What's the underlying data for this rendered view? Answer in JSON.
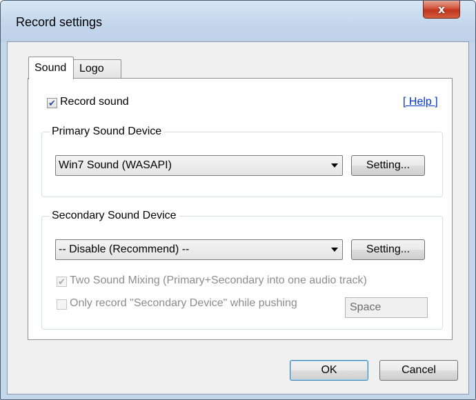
{
  "window": {
    "title": "Record settings",
    "close_glyph": "x"
  },
  "tabs": [
    {
      "label": "Sound",
      "selected": true
    },
    {
      "label": "Logo",
      "selected": false
    }
  ],
  "sound_tab": {
    "record_sound": {
      "label": "Record sound",
      "checked": true
    },
    "help_link": "[ Help ]",
    "primary": {
      "legend": "Primary Sound Device",
      "device": "Win7 Sound (WASAPI)",
      "setting_button": "Setting..."
    },
    "secondary": {
      "legend": "Secondary Sound Device",
      "device": "-- Disable (Recommend) --",
      "setting_button": "Setting...",
      "two_sound_mixing": {
        "label": "Two Sound Mixing (Primary+Secondary into one audio track)",
        "checked": true,
        "enabled": false
      },
      "only_record_secondary": {
        "label": "Only record \"Secondary Device\" while pushing",
        "checked": false,
        "enabled": false
      },
      "hotkey_value": "Space"
    }
  },
  "footer": {
    "ok": "OK",
    "cancel": "Cancel"
  },
  "colors": {
    "highlight": "#e3141b",
    "link": "#0033cc",
    "close_button": "#c8442a"
  }
}
